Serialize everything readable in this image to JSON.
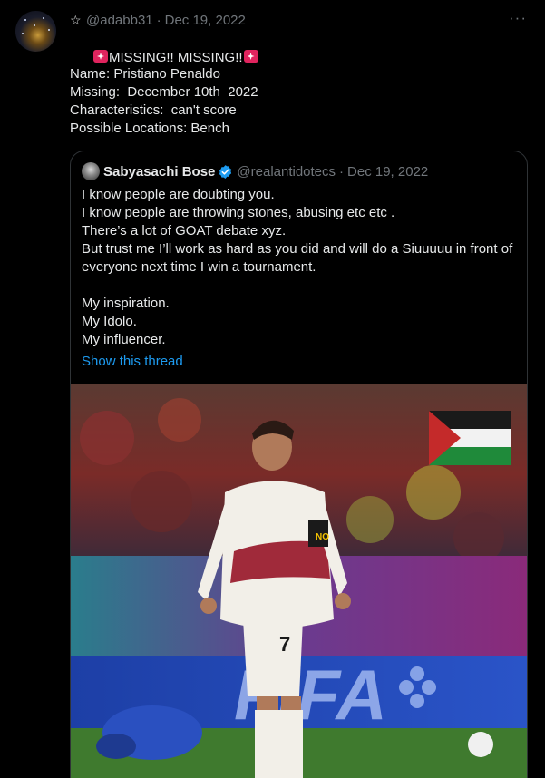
{
  "tweet": {
    "handle": "@adabb31",
    "separator": "·",
    "date": "Dec 19, 2022",
    "title_text": "MISSING!! MISSING!!",
    "lines": [
      "Name: Pristiano Penaldo",
      "Missing:  December 10th  2022",
      "Characteristics:  can't score",
      "Possible Locations: Bench"
    ],
    "icons": {
      "star": "star-icon",
      "more": "more-icon",
      "siren": "police-light-icon"
    },
    "more_glyph": "···"
  },
  "quoted": {
    "name": "Sabyasachi Bose",
    "handle": "@realantidotecs",
    "separator": "·",
    "date": "Dec 19, 2022",
    "lines": [
      "I know people are doubting you.",
      "I know people are throwing stones, abusing etc etc .",
      "There’s a lot of GOAT debate xyz.",
      "But trust me I’ll work as hard as you did and will do a Siuuuuu in front of everyone next time I win a tournament."
    ],
    "lines2": [
      "My inspiration.",
      "My Idolo.",
      "My influencer."
    ],
    "show_thread": "Show this thread",
    "image": {
      "jersey_number": "7",
      "banner_text": "FIFA"
    }
  },
  "colors": {
    "background": "#000000",
    "text": "#e7e9ea",
    "muted": "#71767b",
    "link": "#1d9bf0",
    "border": "#2f3336",
    "siren": "#e0245e"
  }
}
